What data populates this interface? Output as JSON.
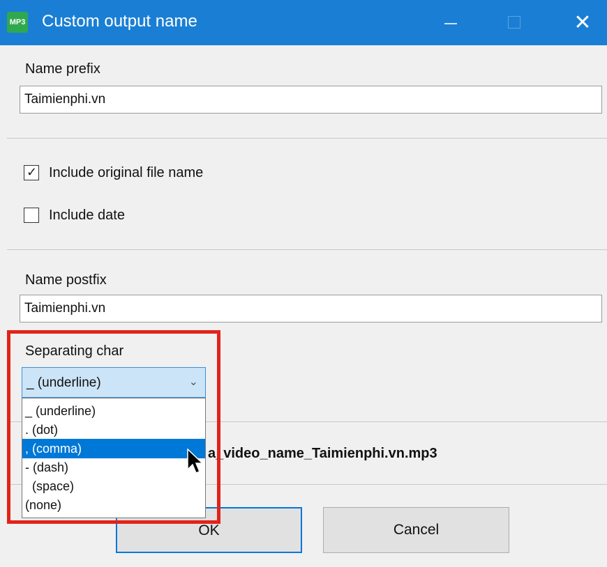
{
  "window": {
    "title": "Custom output name",
    "app_icon_text": "MP3",
    "minimize_glyph": "—",
    "close_glyph": "✕"
  },
  "prefix": {
    "label": "Name prefix",
    "value": "Taimienphi.vn"
  },
  "options": {
    "include_original": {
      "label": "Include original file name",
      "checked": true
    },
    "include_date": {
      "label": "Include date",
      "checked": false
    }
  },
  "postfix": {
    "label": "Name postfix",
    "value": "Taimienphi.vn"
  },
  "separator": {
    "label": "Separating char",
    "selected": "_ (underline)",
    "dropdown_open": true,
    "items": [
      "_ (underline)",
      ". (dot)",
      ", (comma)",
      "- (dash)",
      "  (space)",
      "(none)"
    ],
    "highlighted_item": ", (comma)"
  },
  "preview": {
    "text": "a_video_name_Taimienphi.vn.mp3"
  },
  "buttons": {
    "ok": "OK",
    "cancel": "Cancel"
  },
  "colors": {
    "titlebar": "#1a7fd4",
    "selection": "#0078d7",
    "annotation": "#e2231a"
  }
}
